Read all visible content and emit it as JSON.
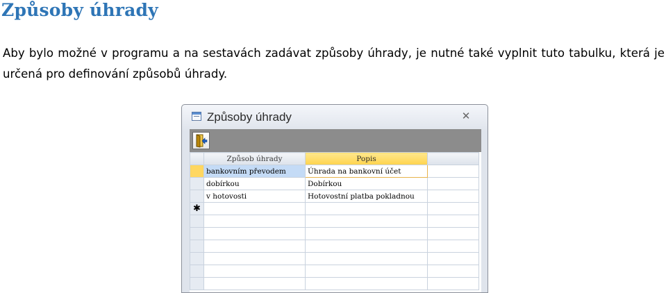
{
  "heading": "Způsoby úhrady",
  "paragraph": "Aby bylo možné v programu a na sestavách zadávat způsoby úhrady, je nutné také vyplnit tuto tabulku, která je určená pro definování způsobů úhrady.",
  "window": {
    "title": "Způsoby úhrady",
    "close_glyph": "✕",
    "icons": {
      "window": "form-icon",
      "exit": "exit-door-icon",
      "close": "close-icon"
    }
  },
  "grid": {
    "columns": [
      "Způsob úhrady",
      "Popis"
    ],
    "rows": [
      [
        "bankovním převodem",
        "Úhrada na bankovní účet"
      ],
      [
        "dobírkou",
        "Dobírkou"
      ],
      [
        "v hotovosti",
        "Hotovostní platba pokladnou"
      ]
    ],
    "new_row_marker": "✱"
  },
  "colors": {
    "heading": "#2e75b6",
    "selected_header": "#ffd34e",
    "selected_cell": "#c4dbf6",
    "toolbar": "#8c8c8c"
  }
}
